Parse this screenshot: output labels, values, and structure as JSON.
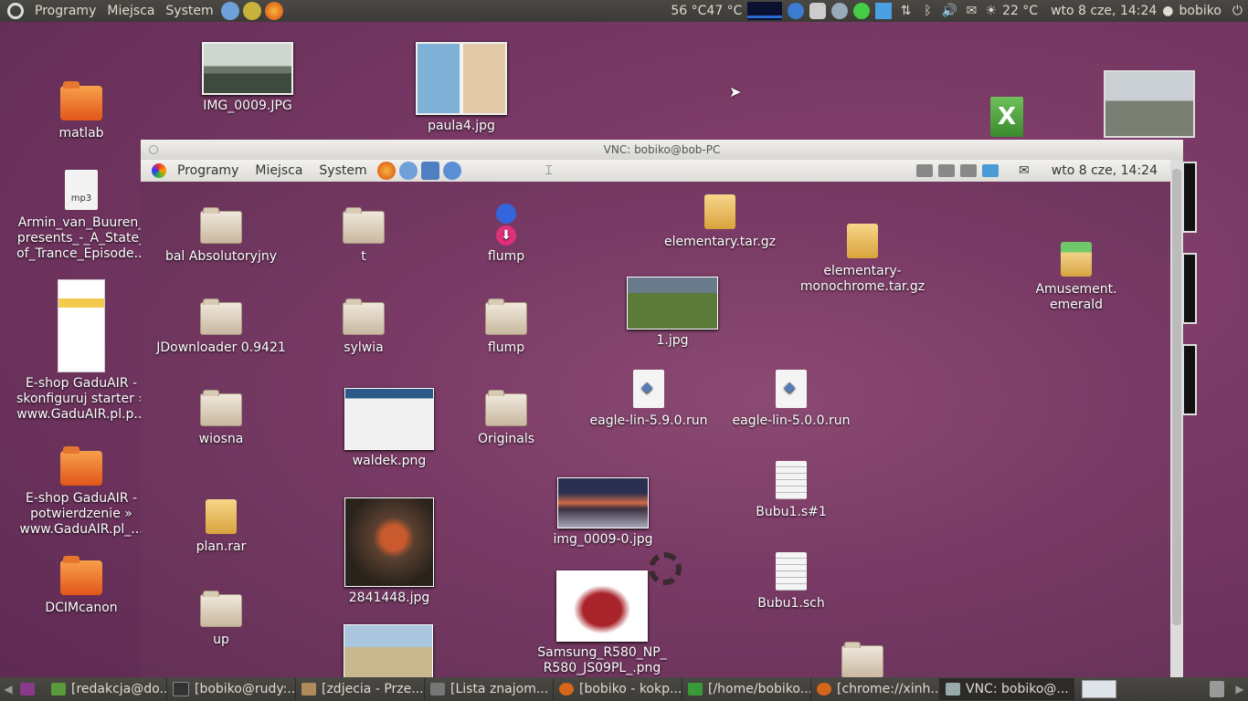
{
  "top_panel": {
    "menus": [
      "Programy",
      "Miejsca",
      "System"
    ],
    "temps": "56 °C47 °C",
    "weather": "22 °C",
    "clock": "wto  8 cze, 14:24",
    "user": "bobiko"
  },
  "desktop_icons": {
    "matlab": "matlab",
    "armin": "Armin_van_Buuren_ presents_-_A_State_ of_Trance_Episode...",
    "mp3_badge": "mp3",
    "eshop1": "E-shop GaduAIR - skonfiguruj starter » www.GaduAIR.pl.p...",
    "eshop2": "E-shop GaduAIR - potwierdzenie » www.GaduAIR.pl_...",
    "dcim": "DCIMcanon",
    "img0009": "IMG_0009.JPG",
    "paula4": "paula4.jpg",
    "excel_glyph": "X"
  },
  "vnc_window": {
    "title": "VNC: bobiko@bob-PC",
    "inner_panel": {
      "menus": [
        "Programy",
        "Miejsca",
        "System"
      ],
      "clock": "wto  8 cze, 14:24"
    },
    "icons": {
      "bal": "bal Absolutoryjny",
      "t": "t",
      "flump1": "flump",
      "elementary": "elementary.tar.gz",
      "elementary_mono": "elementary- monochrome.tar.gz",
      "amusement": "Amusement. emerald",
      "jdownloader": "JDownloader 0.9421",
      "sylwia": "sylwia",
      "flump2": "flump",
      "jpg1": "1.jpg",
      "wiosna": "wiosna",
      "waldek": "waldek.png",
      "originals": "Originals",
      "eagle59": "eagle-lin-5.9.0.run",
      "eagle50": "eagle-lin-5.0.0.run",
      "plan": "plan.rar",
      "p2841448": "2841448.jpg",
      "img0009_0": "img_0009-0.jpg",
      "bubu_s": "Bubu1.s#1",
      "up": "up",
      "samsung": "Samsung_R580_NP_ R580_JS09PL_.png",
      "bubu_sch": "Bubu1.sch"
    }
  },
  "taskbar": {
    "items": [
      "[redakcja@do...",
      "[bobiko@rudy:...",
      "[zdjecia - Prze...",
      "[Lista znajom...",
      "[bobiko - kokp...",
      "[/home/bobiko...",
      "[chrome://xinh...",
      "VNC: bobiko@..."
    ]
  }
}
